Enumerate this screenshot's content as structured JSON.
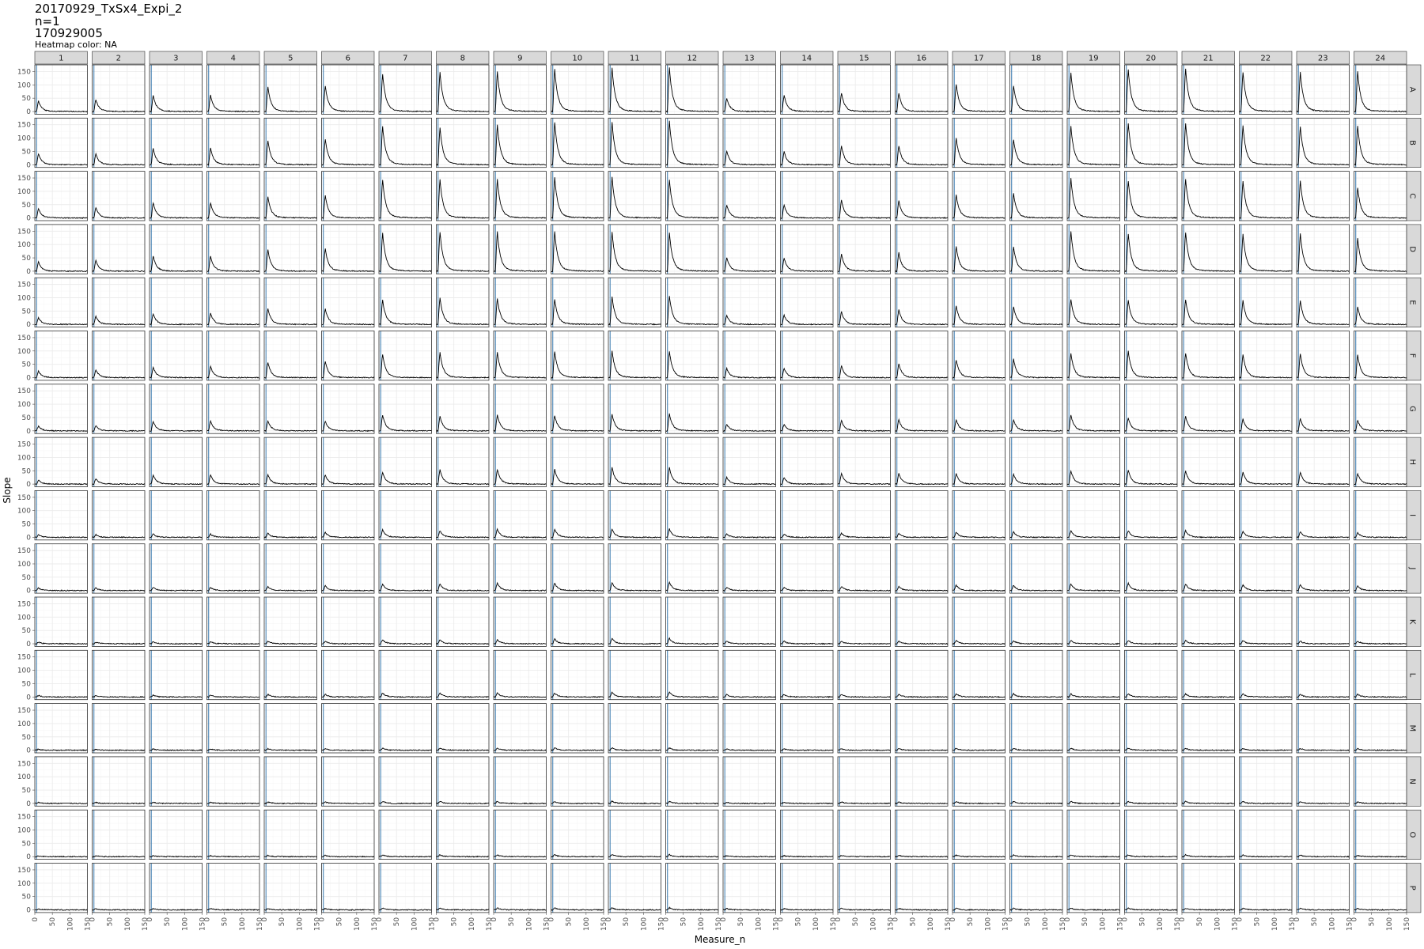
{
  "header": {
    "title": "20170929_TxSx4_Expi_2",
    "line2": "n=1",
    "line3": "170929005",
    "line4": "Heatmap color: NA"
  },
  "chart_data": {
    "type": "line",
    "facet_columns": [
      "1",
      "2",
      "3",
      "4",
      "5",
      "6",
      "7",
      "8",
      "9",
      "10",
      "11",
      "12",
      "13",
      "14",
      "15",
      "16",
      "17",
      "18",
      "19",
      "20",
      "21",
      "22",
      "23",
      "24"
    ],
    "facet_rows": [
      "A",
      "B",
      "C",
      "D",
      "E",
      "F",
      "G",
      "H",
      "I",
      "J",
      "K",
      "L",
      "M",
      "N",
      "O",
      "P"
    ],
    "xlabel": "Measure_n",
    "ylabel": "Slope",
    "xlim": [
      0,
      150
    ],
    "ylim": [
      -10,
      175
    ],
    "x_ticks": [
      0,
      50,
      100,
      150
    ],
    "y_ticks": [
      0,
      50,
      100,
      150
    ],
    "x_tick_labels": [
      "0",
      "50",
      "100",
      "150"
    ],
    "y_tick_labels": [
      "0",
      "50",
      "100",
      "150"
    ],
    "vline_x": 5,
    "grid": true,
    "curve_model": "Each facet shows a single transient: rises from ~0 to a peak near Measure_n 10, then decays back to ~0 by Measure_n ~60. Values below are estimated peak heights (Slope units).",
    "peak_x": 10,
    "peaks": {
      "A": [
        40,
        45,
        60,
        62,
        92,
        97,
        142,
        148,
        150,
        160,
        165,
        165,
        50,
        62,
        70,
        70,
        103,
        97,
        145,
        157,
        160,
        148,
        148,
        150
      ],
      "B": [
        42,
        40,
        62,
        63,
        92,
        97,
        145,
        140,
        150,
        160,
        160,
        165,
        52,
        50,
        72,
        72,
        102,
        95,
        145,
        157,
        157,
        147,
        145,
        147
      ],
      "C": [
        35,
        40,
        57,
        57,
        80,
        85,
        145,
        145,
        145,
        155,
        155,
        145,
        50,
        50,
        68,
        65,
        87,
        92,
        150,
        140,
        147,
        140,
        140,
        115
      ],
      "D": [
        35,
        40,
        57,
        57,
        80,
        85,
        145,
        148,
        148,
        150,
        148,
        145,
        52,
        50,
        65,
        70,
        92,
        92,
        150,
        140,
        147,
        140,
        142,
        125
      ],
      "E": [
        25,
        30,
        40,
        42,
        60,
        60,
        92,
        100,
        98,
        95,
        105,
        108,
        35,
        35,
        48,
        55,
        70,
        67,
        95,
        90,
        92,
        90,
        90,
        65
      ],
      "F": [
        25,
        30,
        40,
        42,
        58,
        62,
        88,
        95,
        95,
        100,
        100,
        100,
        35,
        35,
        45,
        52,
        67,
        70,
        92,
        100,
        92,
        88,
        90,
        85
      ],
      "G": [
        18,
        20,
        35,
        37,
        38,
        37,
        60,
        55,
        60,
        58,
        62,
        65,
        25,
        25,
        40,
        42,
        42,
        42,
        60,
        48,
        55,
        45,
        47,
        40
      ],
      "H": [
        15,
        20,
        35,
        35,
        35,
        35,
        45,
        55,
        55,
        55,
        62,
        62,
        25,
        25,
        40,
        40,
        40,
        38,
        50,
        52,
        50,
        45,
        45,
        40
      ],
      "I": [
        10,
        10,
        12,
        12,
        15,
        18,
        28,
        25,
        30,
        30,
        30,
        32,
        12,
        12,
        15,
        15,
        20,
        20,
        25,
        25,
        25,
        22,
        22,
        18
      ],
      "J": [
        10,
        10,
        12,
        12,
        15,
        18,
        25,
        25,
        28,
        28,
        30,
        32,
        12,
        12,
        15,
        15,
        20,
        20,
        25,
        28,
        25,
        22,
        22,
        18
      ],
      "K": [
        6,
        6,
        7,
        8,
        10,
        10,
        15,
        15,
        15,
        18,
        20,
        20,
        10,
        10,
        10,
        10,
        12,
        12,
        12,
        12,
        12,
        12,
        10,
        10
      ],
      "L": [
        6,
        6,
        7,
        8,
        10,
        10,
        15,
        15,
        15,
        15,
        18,
        18,
        10,
        10,
        10,
        10,
        12,
        12,
        12,
        12,
        12,
        12,
        10,
        10
      ],
      "M": [
        4,
        4,
        5,
        5,
        6,
        6,
        8,
        8,
        8,
        9,
        9,
        9,
        5,
        5,
        6,
        6,
        7,
        7,
        8,
        8,
        8,
        7,
        7,
        6
      ],
      "N": [
        4,
        4,
        5,
        5,
        6,
        6,
        8,
        8,
        8,
        8,
        9,
        9,
        5,
        5,
        6,
        6,
        7,
        7,
        8,
        8,
        8,
        7,
        7,
        6
      ],
      "O": [
        3,
        3,
        4,
        4,
        5,
        5,
        7,
        7,
        7,
        7,
        8,
        8,
        4,
        4,
        5,
        5,
        6,
        6,
        7,
        7,
        7,
        6,
        6,
        5
      ],
      "P": [
        3,
        4,
        5,
        5,
        5,
        5,
        7,
        7,
        7,
        8,
        8,
        8,
        5,
        5,
        6,
        6,
        6,
        6,
        7,
        7,
        7,
        6,
        6,
        5
      ]
    },
    "colors": {
      "strip_fill": "#d9d9d9",
      "strip_text": "#1a1a1a",
      "panel_border": "#333333",
      "grid_major": "#ebebeb",
      "grid_minor": "#f5f5f5",
      "line": "#000000",
      "vline": "#4682b4",
      "axis_text": "#4d4d4d"
    }
  }
}
